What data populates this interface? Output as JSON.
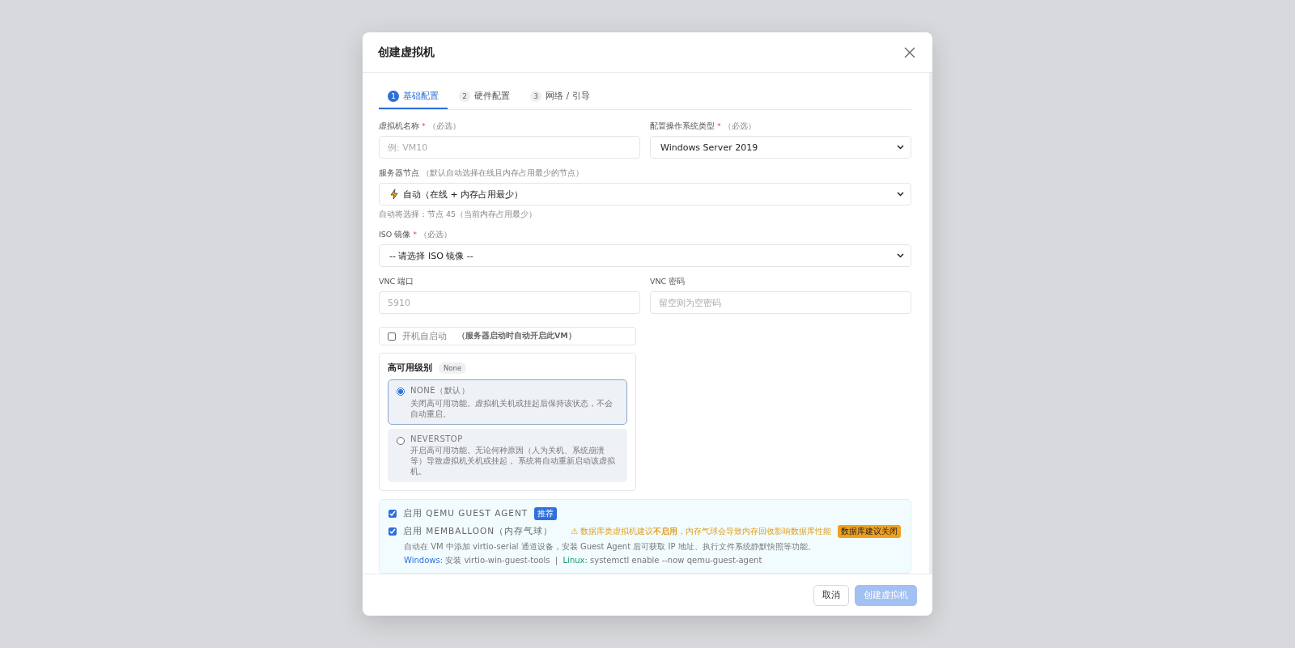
{
  "dialog": {
    "title": "创建虚拟机",
    "tabs": [
      {
        "number": "1",
        "label": "基础配置",
        "selected": true
      },
      {
        "number": "2",
        "label": "硬件配置",
        "selected": false
      },
      {
        "number": "3",
        "label": "网络 / 引导",
        "selected": false
      }
    ],
    "vm_name": {
      "label": "虚拟机名称",
      "required_mark": "*",
      "note": "（必选）",
      "placeholder": "例: VM10"
    },
    "os_type": {
      "label": "配置操作系统类型",
      "required_mark": "*",
      "note": "（必选）",
      "value": "Windows Server 2019"
    },
    "node": {
      "label": "服务器节点",
      "note": "（默认自动选择在线且内存占用最少的节点）",
      "value": "自动（在线 + 内存占用最少）",
      "hint": "自动将选择：节点 45（当前内存占用最少）"
    },
    "iso": {
      "label": "ISO 镜像",
      "required_mark": "*",
      "note": "（必选）",
      "value": "-- 请选择 ISO 镜像 --"
    },
    "vnc_port": {
      "label": "VNC 端口",
      "placeholder": "5910"
    },
    "vnc_password": {
      "label": "VNC 密码",
      "placeholder": "留空则为空密码"
    },
    "autostart": {
      "label": "开机自启动",
      "note": "（服务器启动时自动开启此VM）",
      "checked": false
    },
    "ha": {
      "title": "高可用级别",
      "badge": "None",
      "options": [
        {
          "name": "NONE（默认）",
          "description": "关闭高可用功能。虚拟机关机或挂起后保持该状态，不会自动重启。",
          "selected": true
        },
        {
          "name": "NEVERSTOP",
          "description": "开启高可用功能。无论何种原因（人为关机、系统崩溃等）导致虚拟机关机或挂起， 系统将自动重新启动该虚拟机。",
          "selected": false
        }
      ]
    },
    "agent": {
      "options": [
        {
          "label": "启用 QEMU GUEST AGENT",
          "checked": true,
          "badge": {
            "text": "推荐",
            "kind": "info"
          }
        },
        {
          "label": "启用 MEMBALLOON（内存气球）",
          "checked": true,
          "warning": "⚠ 数据库类虚拟机建议**不启用**，内存气球会导致内存回收影响数据库性能",
          "badge": {
            "text": "数据库建议关闭",
            "kind": "warning"
          }
        }
      ],
      "description": "自动在 VM 中添加 virtio-serial 通道设备，安装 Guest Agent 后可获取 IP 地址、执行文件系统静默快照等功能。",
      "windows_label": "Windows:",
      "windows_text": "安装 virtio-win-guest-tools",
      "separator": "|",
      "linux_label": "Linux:",
      "linux_text": "systemctl enable --now qemu-guest-agent"
    },
    "buttons": [
      {
        "label": "取消",
        "kind": "secondary",
        "disabled": false
      },
      {
        "label": "创建虚拟机",
        "kind": "primary",
        "disabled": true
      }
    ]
  }
}
